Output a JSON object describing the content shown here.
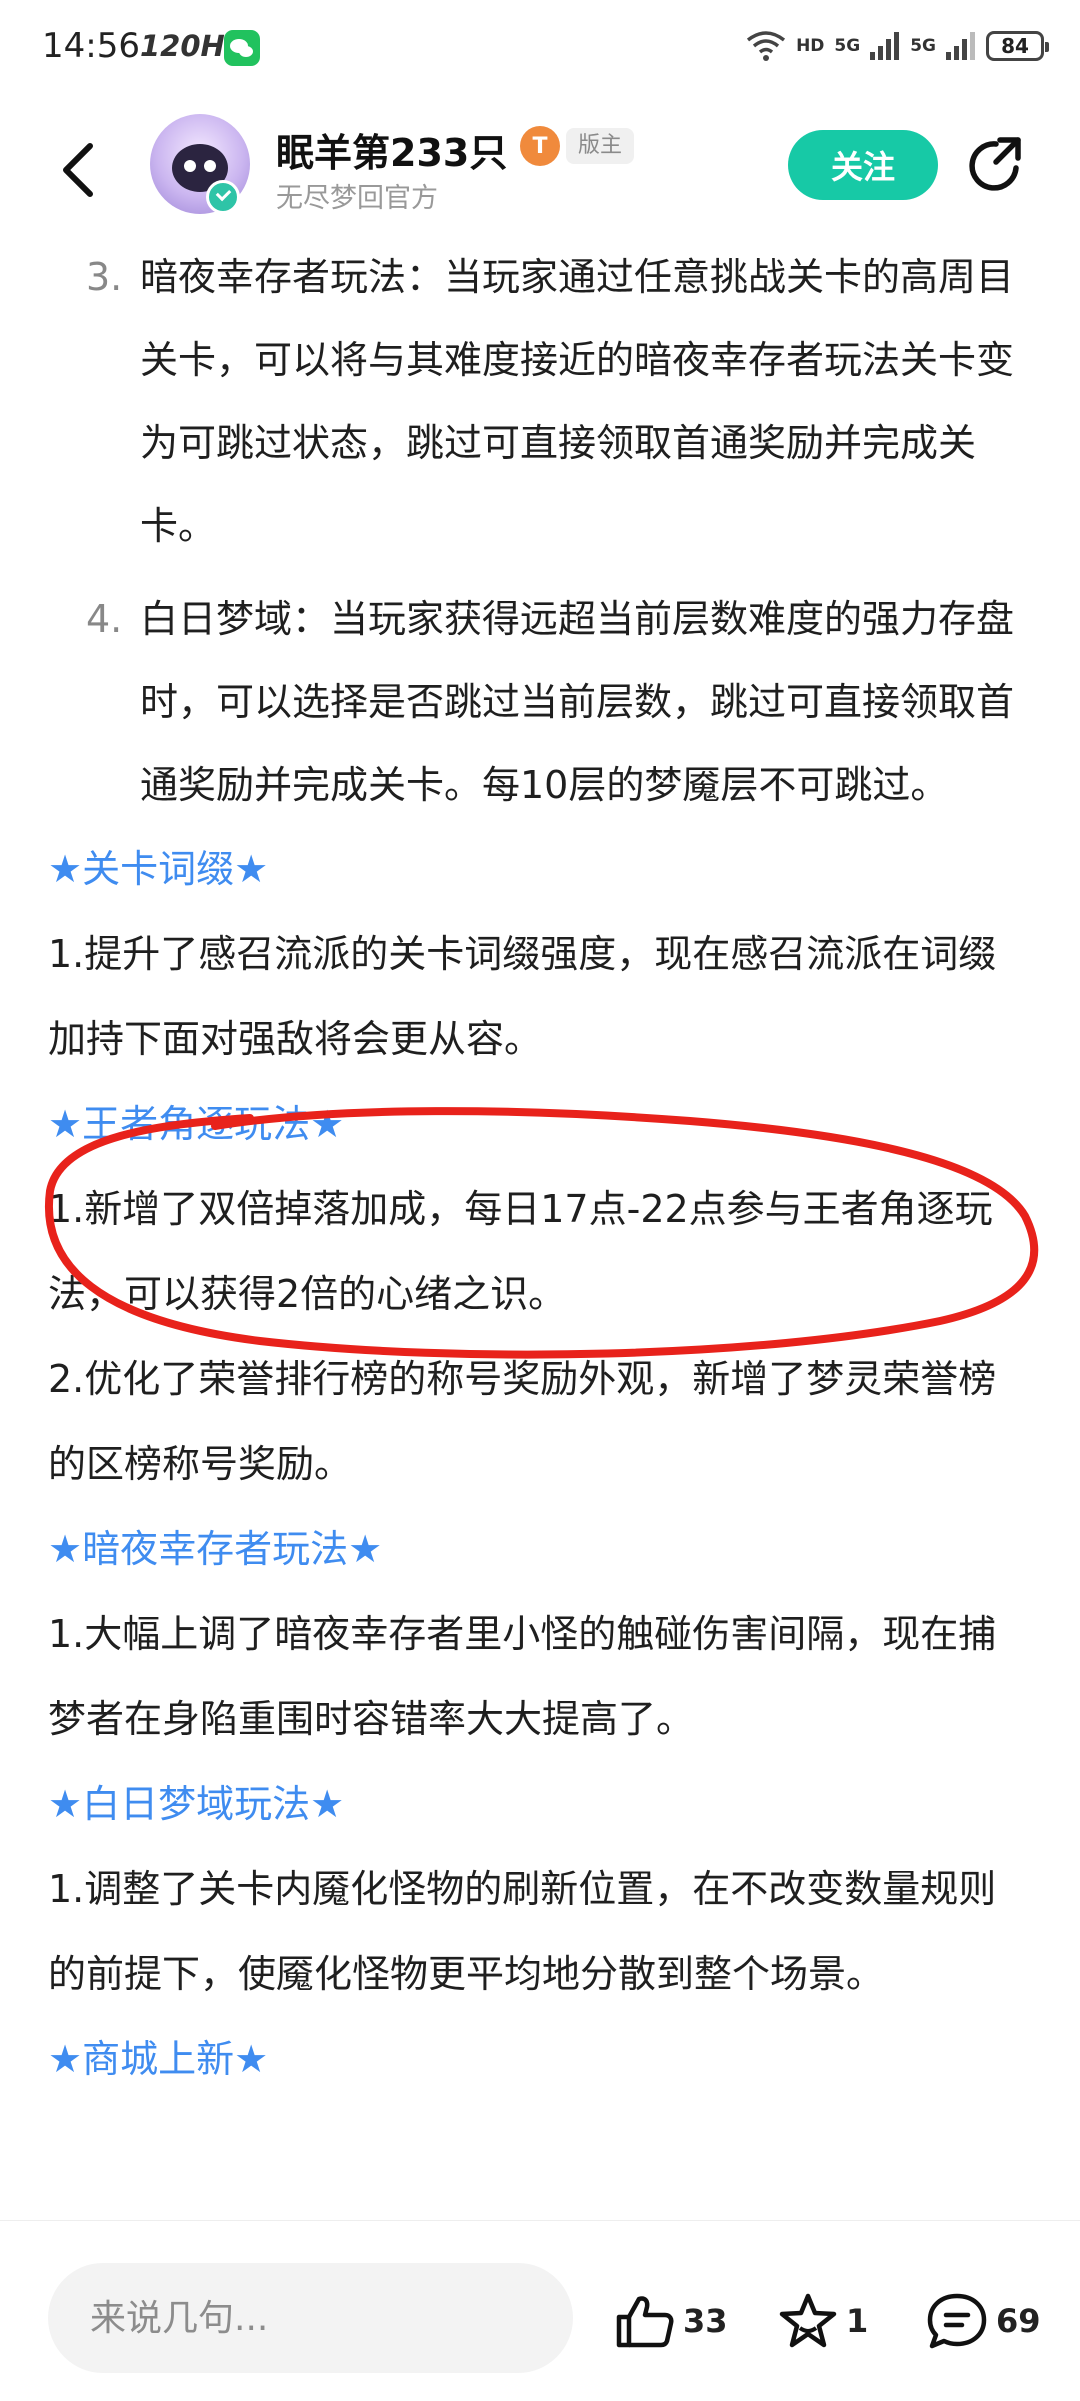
{
  "status_bar": {
    "time": "14:56",
    "refresh_rate": "120Hz",
    "network_labels": [
      "HD",
      "5G",
      "5G"
    ],
    "battery": "84"
  },
  "header": {
    "author_name": "眠羊第233只",
    "level_badge": "T",
    "role_badge": "版主",
    "author_subtitle": "无尽梦回官方",
    "follow_label": "关注"
  },
  "content": {
    "items": [
      {
        "num": "3.",
        "text": "暗夜幸存者玩法：当玩家通过任意挑战关卡的高周目关卡，可以将与其难度接近的暗夜幸存者玩法关卡变为可跳过状态，跳过可直接领取首通奖励并完成关卡。"
      },
      {
        "num": "4.",
        "text": "白日梦域：当玩家获得远超当前层数难度的强力存盘时，可以选择是否跳过当前层数，跳过可直接领取首通奖励并完成关卡。每10层的梦魇层不可跳过。"
      }
    ],
    "sections": [
      {
        "title": "★关卡词缀★",
        "paras": [
          "1.提升了感召流派的关卡词缀强度，现在感召流派在词缀加持下面对强敌将会更从容。"
        ]
      },
      {
        "title": "★王者角逐玩法★",
        "paras": [
          "1.新增了双倍掉落加成，每日17点-22点参与王者角逐玩法，可以获得2倍的心绪之识。",
          "2.优化了荣誉排行榜的称号奖励外观，新增了梦灵荣誉榜的区榜称号奖励。"
        ]
      },
      {
        "title": "★暗夜幸存者玩法★",
        "paras": [
          "1.大幅上调了暗夜幸存者里小怪的触碰伤害间隔，现在捕梦者在身陷重围时容错率大大提高了。"
        ]
      },
      {
        "title": "★白日梦域玩法★",
        "paras": [
          "1.调整了关卡内魇化怪物的刷新位置，在不改变数量规则的前提下，使魇化怪物更平均地分散到整个场景。"
        ]
      },
      {
        "title": "★商城上新★",
        "paras": []
      }
    ]
  },
  "bottom_bar": {
    "comment_placeholder": "来说几句...",
    "like_count": "33",
    "favorite_count": "1",
    "comment_count": "69"
  },
  "colors": {
    "accent_teal": "#17c9a6",
    "section_blue": "#3f8cf0",
    "annotation_red": "#e8221b",
    "level_orange": "#f08a3c"
  }
}
